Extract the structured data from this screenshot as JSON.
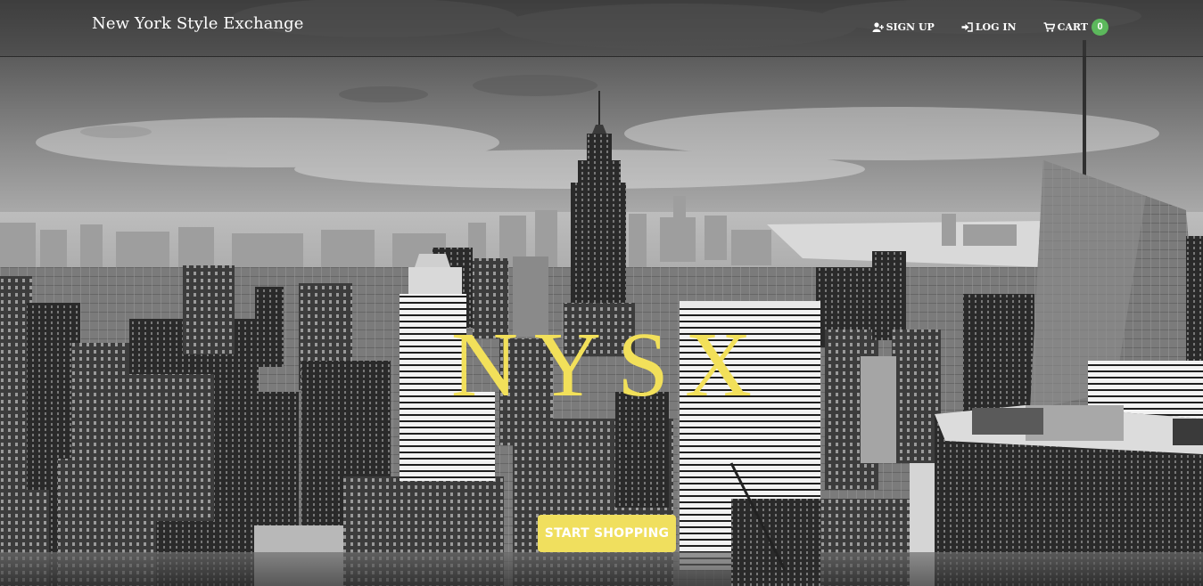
{
  "brand": {
    "name": "New York Style Exchange"
  },
  "nav": {
    "signup_label": "SIGN UP",
    "login_label": "LOG IN",
    "cart_label": "CART",
    "cart_count": "0",
    "signup_icon": "user-plus-icon",
    "login_icon": "sign-in-icon",
    "cart_icon": "shopping-cart-icon"
  },
  "hero": {
    "title": "NYSX",
    "cta_label": "START SHOPPING",
    "background": "grayscale-new-york-skyline-photo"
  },
  "colors": {
    "accent": "#f0df5e",
    "title": "#f2e05a",
    "badge": "#5cb85c"
  }
}
